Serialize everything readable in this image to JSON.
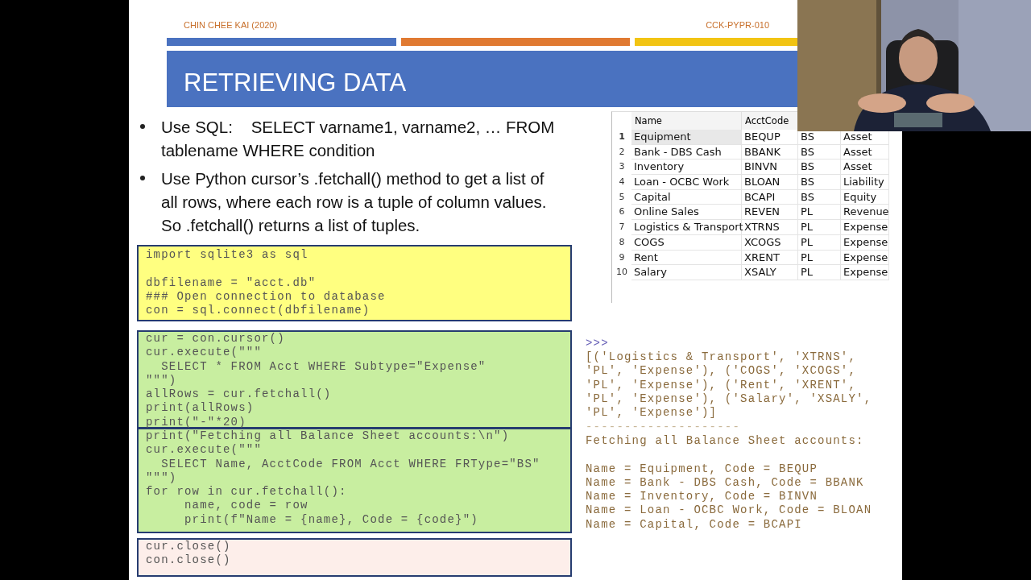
{
  "header": {
    "author": "CHIN CHEE KAI (2020)",
    "code": "CCK-PYPR-010",
    "title": "RETRIEVING DATA"
  },
  "bullets": [
    "Use SQL:    SELECT varname1, varname2, … FROM\ntablename WHERE condition",
    "Use Python cursor’s .fetchall() method to get a list of\nall rows, where each row is a tuple of column values.\nSo .fetchall() returns a list of tuples."
  ],
  "code_blocks": [
    {
      "color": "#ffff80",
      "code": "import sqlite3 as sql\n\ndbfilename = \"acct.db\"\n### Open connection to database\ncon = sql.connect(dbfilename)"
    },
    {
      "color": "#c8eea0",
      "code": "cur = con.cursor()\ncur.execute(\"\"\"\n  SELECT * FROM Acct WHERE Subtype=\"Expense\"\n\"\"\")\nallRows = cur.fetchall()\nprint(allRows)\nprint(\"-\"*20)"
    },
    {
      "color": "#c8eea0",
      "code": "print(\"Fetching all Balance Sheet accounts:\\n\")\ncur.execute(\"\"\"\n  SELECT Name, AcctCode FROM Acct WHERE FRType=\"BS\"\n\"\"\")\nfor row in cur.fetchall():\n     name, code = row\n     print(f\"Name = {name}, Code = {code}\")"
    },
    {
      "color": "#fdeeea",
      "code": "cur.close()\ncon.close()"
    }
  ],
  "table": {
    "columns": [
      "Name",
      "AcctCode"
    ],
    "rows": [
      {
        "index": "1",
        "selected": true,
        "cells": [
          "Equipment",
          "BEQUP",
          "BS",
          "Asset"
        ]
      },
      {
        "index": "2",
        "selected": false,
        "cells": [
          "Bank - DBS Cash",
          "BBANK",
          "BS",
          "Asset"
        ]
      },
      {
        "index": "3",
        "selected": false,
        "cells": [
          "Inventory",
          "BINVN",
          "BS",
          "Asset"
        ]
      },
      {
        "index": "4",
        "selected": false,
        "cells": [
          "Loan - OCBC Work",
          "BLOAN",
          "BS",
          "Liability"
        ]
      },
      {
        "index": "5",
        "selected": false,
        "cells": [
          "Capital",
          "BCAPI",
          "BS",
          "Equity"
        ]
      },
      {
        "index": "6",
        "selected": false,
        "cells": [
          "Online Sales",
          "REVEN",
          "PL",
          "Revenue"
        ]
      },
      {
        "index": "7",
        "selected": false,
        "cells": [
          "Logistics & Transport",
          "XTRNS",
          "PL",
          "Expense"
        ]
      },
      {
        "index": "8",
        "selected": false,
        "cells": [
          "COGS",
          "XCOGS",
          "PL",
          "Expense"
        ]
      },
      {
        "index": "9",
        "selected": false,
        "cells": [
          "Rent",
          "XRENT",
          "PL",
          "Expense"
        ]
      },
      {
        "index": "10",
        "selected": false,
        "cells": [
          "Salary",
          "XSALY",
          "PL",
          "Expense"
        ]
      }
    ]
  },
  "console": [
    {
      "kind": "prompt",
      "text": ">>>"
    },
    {
      "kind": "output",
      "text": "[('Logistics & Transport', 'XTRNS',\n'PL', 'Expense'), ('COGS', 'XCOGS',\n'PL', 'Expense'), ('Rent', 'XRENT',\n'PL', 'Expense'), ('Salary', 'XSALY',\n'PL', 'Expense')]"
    },
    {
      "kind": "rule",
      "text": "--------------------"
    },
    {
      "kind": "output",
      "text": "Fetching all Balance Sheet accounts:\n\nName = Equipment, Code = BEQUP\nName = Bank - DBS Cash, Code = BBANK\nName = Inventory, Code = BINVN\nName = Loan - OCBC Work, Code = BLOAN\nName = Capital, Code = BCAPI"
    }
  ]
}
